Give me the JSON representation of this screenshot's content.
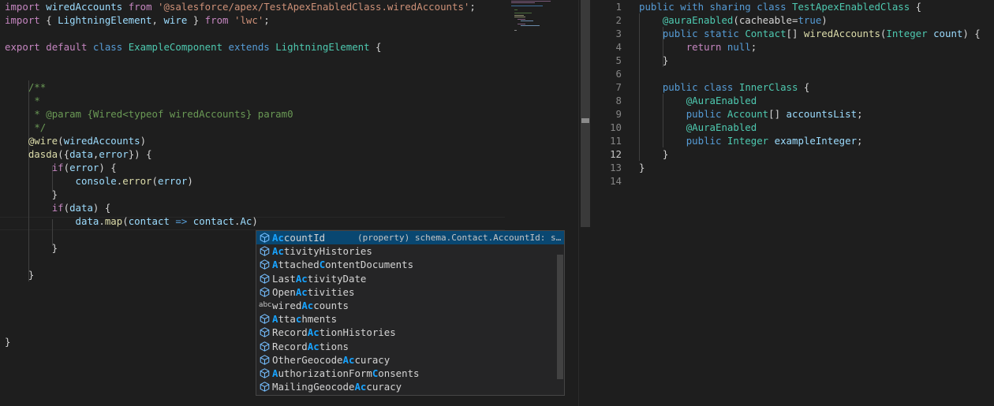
{
  "left_editor": {
    "lines": [
      {
        "tokens": [
          [
            "kw",
            "import"
          ],
          [
            "pl",
            " "
          ],
          [
            "var",
            "wiredAccounts"
          ],
          [
            "pl",
            " "
          ],
          [
            "kw",
            "from"
          ],
          [
            "pl",
            " "
          ],
          [
            "str",
            "'@salesforce/apex/TestApexEnabledClass.wiredAccounts'"
          ],
          [
            "pl",
            ";"
          ]
        ]
      },
      {
        "tokens": [
          [
            "kw",
            "import"
          ],
          [
            "pl",
            " { "
          ],
          [
            "var",
            "LightningElement"
          ],
          [
            "pl",
            ", "
          ],
          [
            "var",
            "wire"
          ],
          [
            "pl",
            " } "
          ],
          [
            "kw",
            "from"
          ],
          [
            "pl",
            " "
          ],
          [
            "str",
            "'lwc'"
          ],
          [
            "pl",
            ";"
          ]
        ]
      },
      {
        "tokens": []
      },
      {
        "tokens": [
          [
            "kw",
            "export"
          ],
          [
            "pl",
            " "
          ],
          [
            "kw",
            "default"
          ],
          [
            "pl",
            " "
          ],
          [
            "kb",
            "class"
          ],
          [
            "pl",
            " "
          ],
          [
            "typ",
            "ExampleComponent"
          ],
          [
            "pl",
            " "
          ],
          [
            "kb",
            "extends"
          ],
          [
            "pl",
            " "
          ],
          [
            "typ",
            "LightningElement"
          ],
          [
            "pl",
            " {"
          ]
        ]
      },
      {
        "tokens": []
      },
      {
        "tokens": []
      },
      {
        "tokens": [
          [
            "pl",
            "    "
          ],
          [
            "cm",
            "/**"
          ]
        ]
      },
      {
        "tokens": [
          [
            "pl",
            "     "
          ],
          [
            "cm",
            "*"
          ]
        ]
      },
      {
        "tokens": [
          [
            "pl",
            "     "
          ],
          [
            "cm",
            "* @param {Wired<typeof wiredAccounts} param0"
          ]
        ]
      },
      {
        "tokens": [
          [
            "pl",
            "     "
          ],
          [
            "cm",
            "*/"
          ]
        ]
      },
      {
        "tokens": [
          [
            "pl",
            "    "
          ],
          [
            "fn",
            "@wire"
          ],
          [
            "pl",
            "("
          ],
          [
            "var",
            "wiredAccounts"
          ],
          [
            "pl",
            ")"
          ]
        ]
      },
      {
        "tokens": [
          [
            "pl",
            "    "
          ],
          [
            "fn",
            "dasda"
          ],
          [
            "pl",
            "({"
          ],
          [
            "var",
            "data"
          ],
          [
            "pl",
            ","
          ],
          [
            "var",
            "error"
          ],
          [
            "pl",
            "}) {"
          ]
        ]
      },
      {
        "tokens": [
          [
            "pl",
            "        "
          ],
          [
            "kw",
            "if"
          ],
          [
            "pl",
            "("
          ],
          [
            "var",
            "error"
          ],
          [
            "pl",
            ") {"
          ]
        ]
      },
      {
        "tokens": [
          [
            "pl",
            "            "
          ],
          [
            "var",
            "console"
          ],
          [
            "pl",
            "."
          ],
          [
            "fn",
            "error"
          ],
          [
            "pl",
            "("
          ],
          [
            "var",
            "error"
          ],
          [
            "pl",
            ")"
          ]
        ]
      },
      {
        "tokens": [
          [
            "pl",
            "        }"
          ]
        ]
      },
      {
        "tokens": [
          [
            "pl",
            "        "
          ],
          [
            "kw",
            "if"
          ],
          [
            "pl",
            "("
          ],
          [
            "var",
            "data"
          ],
          [
            "pl",
            ") {"
          ]
        ]
      },
      {
        "tokens": [
          [
            "pl",
            "            "
          ],
          [
            "var",
            "data"
          ],
          [
            "pl",
            "."
          ],
          [
            "fn",
            "map"
          ],
          [
            "pl",
            "("
          ],
          [
            "var",
            "contact"
          ],
          [
            "pl",
            " "
          ],
          [
            "kb",
            "=>"
          ],
          [
            "pl",
            " "
          ],
          [
            "var",
            "contact"
          ],
          [
            "pl",
            "."
          ],
          [
            "var",
            "Ac"
          ],
          [
            "pl",
            ")"
          ]
        ]
      },
      {
        "tokens": []
      },
      {
        "tokens": [
          [
            "pl",
            "        }"
          ]
        ]
      },
      {
        "tokens": []
      },
      {
        "tokens": [
          [
            "pl",
            "    }"
          ]
        ]
      },
      {
        "tokens": []
      },
      {
        "tokens": []
      },
      {
        "tokens": []
      },
      {
        "tokens": []
      },
      {
        "tokens": [
          [
            "pl",
            "}"
          ]
        ]
      }
    ]
  },
  "suggestions": {
    "detail": "(property) schema.Contact.AccountId: s…",
    "items": [
      {
        "kind": "cube-icon",
        "parts": [
          [
            "h",
            "Ac"
          ],
          [
            "n",
            "countId"
          ]
        ],
        "selected": true
      },
      {
        "kind": "cube-icon",
        "parts": [
          [
            "h",
            "Ac"
          ],
          [
            "n",
            "tivityHistories"
          ]
        ]
      },
      {
        "kind": "cube-icon",
        "parts": [
          [
            "h",
            "A"
          ],
          [
            "n",
            "ttached"
          ],
          [
            "h",
            "C"
          ],
          [
            "n",
            "ontentDocuments"
          ]
        ]
      },
      {
        "kind": "cube-icon",
        "parts": [
          [
            "n",
            "Last"
          ],
          [
            "h",
            "Ac"
          ],
          [
            "n",
            "tivityDate"
          ]
        ]
      },
      {
        "kind": "cube-icon",
        "parts": [
          [
            "n",
            "Open"
          ],
          [
            "h",
            "Ac"
          ],
          [
            "n",
            "tivities"
          ]
        ]
      },
      {
        "kind": "abc-icon",
        "parts": [
          [
            "n",
            "wired"
          ],
          [
            "h",
            "Ac"
          ],
          [
            "n",
            "counts"
          ]
        ]
      },
      {
        "kind": "cube-icon",
        "parts": [
          [
            "h",
            "A"
          ],
          [
            "n",
            "tta"
          ],
          [
            "h",
            "c"
          ],
          [
            "n",
            "hments"
          ]
        ]
      },
      {
        "kind": "cube-icon",
        "parts": [
          [
            "n",
            "Record"
          ],
          [
            "h",
            "Ac"
          ],
          [
            "n",
            "tionHistories"
          ]
        ]
      },
      {
        "kind": "cube-icon",
        "parts": [
          [
            "n",
            "Record"
          ],
          [
            "h",
            "Ac"
          ],
          [
            "n",
            "tions"
          ]
        ]
      },
      {
        "kind": "cube-icon",
        "parts": [
          [
            "n",
            "OtherGeocode"
          ],
          [
            "h",
            "Ac"
          ],
          [
            "n",
            "curacy"
          ]
        ]
      },
      {
        "kind": "cube-icon",
        "parts": [
          [
            "h",
            "A"
          ],
          [
            "n",
            "uthorizationForm"
          ],
          [
            "h",
            "C"
          ],
          [
            "n",
            "onsents"
          ]
        ]
      },
      {
        "kind": "cube-icon",
        "parts": [
          [
            "n",
            "MailingGeocode"
          ],
          [
            "h",
            "Ac"
          ],
          [
            "n",
            "curacy"
          ]
        ]
      }
    ],
    "abc_label": "abc"
  },
  "right_editor": {
    "active_line": 12,
    "lines": [
      {
        "n": "1",
        "tokens": [
          [
            "kb",
            "public"
          ],
          [
            "pl",
            " "
          ],
          [
            "kb",
            "with"
          ],
          [
            "pl",
            " "
          ],
          [
            "kb",
            "sharing"
          ],
          [
            "pl",
            " "
          ],
          [
            "kb",
            "class"
          ],
          [
            "pl",
            " "
          ],
          [
            "typ",
            "TestApexEnabledClass"
          ],
          [
            "pl",
            " {"
          ]
        ]
      },
      {
        "n": "2",
        "tokens": [
          [
            "pl",
            "    "
          ],
          [
            "typ",
            "@auraEnabled"
          ],
          [
            "pl",
            "("
          ],
          [
            "pl",
            "cacheable"
          ],
          [
            "pl",
            "="
          ],
          [
            "kb",
            "true"
          ],
          [
            "pl",
            ")"
          ]
        ]
      },
      {
        "n": "3",
        "tokens": [
          [
            "pl",
            "    "
          ],
          [
            "kb",
            "public"
          ],
          [
            "pl",
            " "
          ],
          [
            "kb",
            "static"
          ],
          [
            "pl",
            " "
          ],
          [
            "typ",
            "Contact"
          ],
          [
            "pl",
            "[] "
          ],
          [
            "fn",
            "wiredAccounts"
          ],
          [
            "pl",
            "("
          ],
          [
            "typ",
            "Integer"
          ],
          [
            "pl",
            " "
          ],
          [
            "var",
            "count"
          ],
          [
            "pl",
            ") {"
          ]
        ]
      },
      {
        "n": "4",
        "tokens": [
          [
            "pl",
            "        "
          ],
          [
            "kw",
            "return"
          ],
          [
            "pl",
            " "
          ],
          [
            "kb",
            "null"
          ],
          [
            "pl",
            ";"
          ]
        ]
      },
      {
        "n": "5",
        "tokens": [
          [
            "pl",
            "    }"
          ]
        ]
      },
      {
        "n": "6",
        "tokens": []
      },
      {
        "n": "7",
        "tokens": [
          [
            "pl",
            "    "
          ],
          [
            "kb",
            "public"
          ],
          [
            "pl",
            " "
          ],
          [
            "kb",
            "class"
          ],
          [
            "pl",
            " "
          ],
          [
            "typ",
            "InnerClass"
          ],
          [
            "pl",
            " {"
          ]
        ]
      },
      {
        "n": "8",
        "tokens": [
          [
            "pl",
            "        "
          ],
          [
            "typ",
            "@AuraEnabled"
          ]
        ]
      },
      {
        "n": "9",
        "tokens": [
          [
            "pl",
            "        "
          ],
          [
            "kb",
            "public"
          ],
          [
            "pl",
            " "
          ],
          [
            "typ",
            "Account"
          ],
          [
            "pl",
            "[] "
          ],
          [
            "var",
            "accountsList"
          ],
          [
            "pl",
            ";"
          ]
        ]
      },
      {
        "n": "10",
        "tokens": [
          [
            "pl",
            "        "
          ],
          [
            "typ",
            "@AuraEnabled"
          ]
        ]
      },
      {
        "n": "11",
        "tokens": [
          [
            "pl",
            "        "
          ],
          [
            "kb",
            "public"
          ],
          [
            "pl",
            " "
          ],
          [
            "typ",
            "Integer"
          ],
          [
            "pl",
            " "
          ],
          [
            "var",
            "exampleInteger"
          ],
          [
            "pl",
            ";"
          ]
        ]
      },
      {
        "n": "12",
        "tokens": [
          [
            "pl",
            "    }"
          ]
        ]
      },
      {
        "n": "13",
        "tokens": [
          [
            "pl",
            "}"
          ]
        ]
      },
      {
        "n": "14",
        "tokens": []
      }
    ]
  }
}
